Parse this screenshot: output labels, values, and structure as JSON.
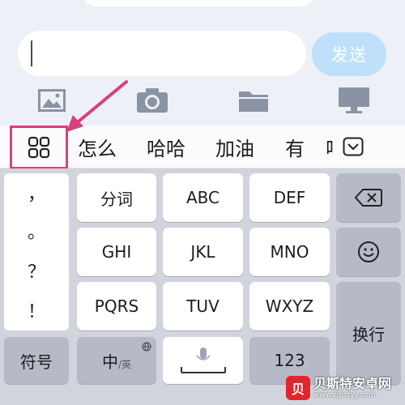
{
  "input": {
    "value": "",
    "send_label": "发送"
  },
  "toolbar": {
    "icons": [
      "image-icon",
      "camera-icon",
      "folder-icon",
      "monitor-icon"
    ]
  },
  "candidates": {
    "items": [
      "怎么",
      "哈哈",
      "加油",
      "有",
      "吧"
    ]
  },
  "keyboard": {
    "punctuation": [
      "，",
      "。",
      "？",
      "！"
    ],
    "rows": [
      [
        "分词",
        "ABC",
        "DEF"
      ],
      [
        "GHI",
        "JKL",
        "MNO"
      ],
      [
        "PQRS",
        "TUV",
        "WXYZ"
      ]
    ],
    "symbol_key": "符号",
    "lang_key_main": "中",
    "lang_key_sub": "/英",
    "num_key": "123",
    "return_key": "换行"
  },
  "watermark": {
    "logo": "贝",
    "title": "贝斯特安卓网",
    "url": "www.zjbstyy.com"
  },
  "colors": {
    "highlight": "#d9407a",
    "send_button": "#bfe0fa",
    "keyboard_bg": "#d1d4dd"
  }
}
